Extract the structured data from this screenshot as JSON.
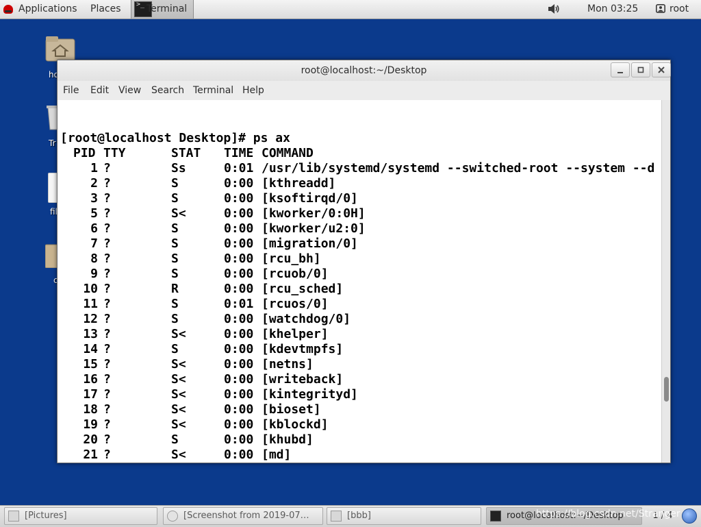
{
  "top_panel": {
    "applications": "Applications",
    "places": "Places",
    "active_window": "Terminal",
    "clock": "Mon 03:25",
    "user": "root",
    "icons": [
      "redhat-logo-icon",
      "terminal-icon",
      "volume-icon",
      "user-icon"
    ]
  },
  "desktop": {
    "icon_labels": [
      "ho",
      "Tr",
      "fil",
      "c"
    ]
  },
  "terminal": {
    "title": "root@localhost:~/Desktop",
    "menu": [
      "File",
      "Edit",
      "View",
      "Search",
      "Terminal",
      "Help"
    ],
    "prompt": "[root@localhost Desktop]# ps ax",
    "header": {
      "pid": "PID",
      "tty": "TTY",
      "stat": "STAT",
      "time": "TIME",
      "command": "COMMAND"
    },
    "rows": [
      {
        "pid": "1",
        "tty": "?",
        "stat": "Ss",
        "time": "0:01",
        "command": "/usr/lib/systemd/systemd --switched-root --system --d"
      },
      {
        "pid": "2",
        "tty": "?",
        "stat": "S",
        "time": "0:00",
        "command": "[kthreadd]"
      },
      {
        "pid": "3",
        "tty": "?",
        "stat": "S",
        "time": "0:00",
        "command": "[ksoftirqd/0]"
      },
      {
        "pid": "5",
        "tty": "?",
        "stat": "S<",
        "time": "0:00",
        "command": "[kworker/0:0H]"
      },
      {
        "pid": "6",
        "tty": "?",
        "stat": "S",
        "time": "0:00",
        "command": "[kworker/u2:0]"
      },
      {
        "pid": "7",
        "tty": "?",
        "stat": "S",
        "time": "0:00",
        "command": "[migration/0]"
      },
      {
        "pid": "8",
        "tty": "?",
        "stat": "S",
        "time": "0:00",
        "command": "[rcu_bh]"
      },
      {
        "pid": "9",
        "tty": "?",
        "stat": "S",
        "time": "0:00",
        "command": "[rcuob/0]"
      },
      {
        "pid": "10",
        "tty": "?",
        "stat": "R",
        "time": "0:00",
        "command": "[rcu_sched]"
      },
      {
        "pid": "11",
        "tty": "?",
        "stat": "S",
        "time": "0:01",
        "command": "[rcuos/0]"
      },
      {
        "pid": "12",
        "tty": "?",
        "stat": "S",
        "time": "0:00",
        "command": "[watchdog/0]"
      },
      {
        "pid": "13",
        "tty": "?",
        "stat": "S<",
        "time": "0:00",
        "command": "[khelper]"
      },
      {
        "pid": "14",
        "tty": "?",
        "stat": "S",
        "time": "0:00",
        "command": "[kdevtmpfs]"
      },
      {
        "pid": "15",
        "tty": "?",
        "stat": "S<",
        "time": "0:00",
        "command": "[netns]"
      },
      {
        "pid": "16",
        "tty": "?",
        "stat": "S<",
        "time": "0:00",
        "command": "[writeback]"
      },
      {
        "pid": "17",
        "tty": "?",
        "stat": "S<",
        "time": "0:00",
        "command": "[kintegrityd]"
      },
      {
        "pid": "18",
        "tty": "?",
        "stat": "S<",
        "time": "0:00",
        "command": "[bioset]"
      },
      {
        "pid": "19",
        "tty": "?",
        "stat": "S<",
        "time": "0:00",
        "command": "[kblockd]"
      },
      {
        "pid": "20",
        "tty": "?",
        "stat": "S",
        "time": "0:00",
        "command": "[khubd]"
      },
      {
        "pid": "21",
        "tty": "?",
        "stat": "S<",
        "time": "0:00",
        "command": "[md]"
      }
    ]
  },
  "taskbar": {
    "items": [
      {
        "label": "[Pictures]",
        "active": false
      },
      {
        "label": "[Screenshot from 2019-07…",
        "active": false
      },
      {
        "label": "[bbb]",
        "active": false
      },
      {
        "label": "root@localhost:~/Desktop",
        "active": true
      }
    ],
    "workspace": "1 / 4",
    "watermark": "https://blog.csdn.net/Stranger"
  },
  "colors": {
    "desktop_bg": "#0b3a8c",
    "panel_bg": "#e5e5e5",
    "terminal_bg": "#ffffff",
    "terminal_fg": "#000000",
    "redhat_red": "#cc0000"
  }
}
